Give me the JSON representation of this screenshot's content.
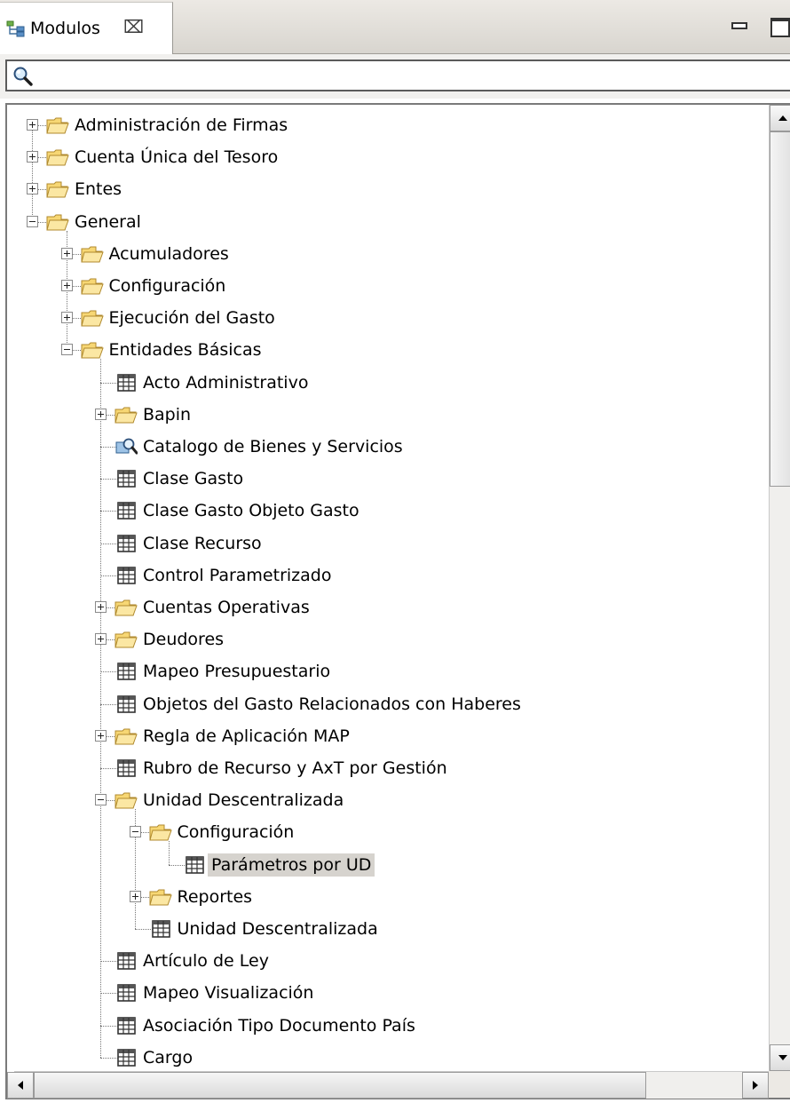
{
  "view": {
    "title": "Modulos",
    "close_glyph": "⌧",
    "icons": {
      "tab": "hierarchy-icon",
      "filter": "magnifier-icon",
      "minimize": "minimize-icon",
      "maximize": "maximize-icon"
    }
  },
  "filter": {
    "value": "",
    "placeholder": ""
  },
  "colors": {
    "folder": "#f5c542",
    "selection": "#d6d3ce"
  },
  "tree": [
    {
      "label": "Administración de Firmas",
      "depth": 0,
      "icon": "folder-icon",
      "expander": "closed"
    },
    {
      "label": "Cuenta Única del Tesoro",
      "depth": 0,
      "icon": "folder-icon",
      "expander": "closed"
    },
    {
      "label": "Entes",
      "depth": 0,
      "icon": "folder-icon",
      "expander": "closed"
    },
    {
      "label": "General",
      "depth": 0,
      "icon": "folder-icon",
      "expander": "open"
    },
    {
      "label": "Acumuladores",
      "depth": 1,
      "icon": "folder-icon",
      "expander": "closed"
    },
    {
      "label": "Configuración",
      "depth": 1,
      "icon": "folder-icon",
      "expander": "closed"
    },
    {
      "label": "Ejecución del Gasto",
      "depth": 1,
      "icon": "folder-icon",
      "expander": "closed"
    },
    {
      "label": "Entidades Básicas",
      "depth": 1,
      "icon": "folder-icon",
      "expander": "open"
    },
    {
      "label": "Acto Administrativo",
      "depth": 2,
      "icon": "table-icon",
      "expander": "none"
    },
    {
      "label": "Bapin",
      "depth": 2,
      "icon": "folder-icon",
      "expander": "closed"
    },
    {
      "label": "Catalogo de Bienes y Servicios",
      "depth": 2,
      "icon": "search-icon",
      "expander": "none"
    },
    {
      "label": "Clase Gasto",
      "depth": 2,
      "icon": "table-icon",
      "expander": "none"
    },
    {
      "label": "Clase Gasto Objeto Gasto",
      "depth": 2,
      "icon": "table-icon",
      "expander": "none"
    },
    {
      "label": "Clase Recurso",
      "depth": 2,
      "icon": "table-icon",
      "expander": "none"
    },
    {
      "label": "Control Parametrizado",
      "depth": 2,
      "icon": "table-icon",
      "expander": "none"
    },
    {
      "label": "Cuentas Operativas",
      "depth": 2,
      "icon": "folder-icon",
      "expander": "closed"
    },
    {
      "label": "Deudores",
      "depth": 2,
      "icon": "folder-icon",
      "expander": "closed"
    },
    {
      "label": "Mapeo Presupuestario",
      "depth": 2,
      "icon": "table-icon",
      "expander": "none"
    },
    {
      "label": "Objetos del Gasto Relacionados con Haberes",
      "depth": 2,
      "icon": "table-icon",
      "expander": "none"
    },
    {
      "label": "Regla de Aplicación MAP",
      "depth": 2,
      "icon": "folder-icon",
      "expander": "closed"
    },
    {
      "label": "Rubro de Recurso y AxT por Gestión",
      "depth": 2,
      "icon": "table-icon",
      "expander": "none"
    },
    {
      "label": "Unidad Descentralizada",
      "depth": 2,
      "icon": "folder-icon",
      "expander": "open"
    },
    {
      "label": "Configuración",
      "depth": 3,
      "icon": "folder-icon",
      "expander": "open"
    },
    {
      "label": "Parámetros por UD",
      "depth": 4,
      "icon": "table-icon",
      "expander": "none",
      "selected": true
    },
    {
      "label": "Reportes",
      "depth": 3,
      "icon": "folder-icon",
      "expander": "closed"
    },
    {
      "label": "Unidad Descentralizada",
      "depth": 3,
      "icon": "table-icon",
      "expander": "none"
    },
    {
      "label": "Artículo de Ley",
      "depth": 2,
      "icon": "table-icon",
      "expander": "none"
    },
    {
      "label": "Mapeo Visualización",
      "depth": 2,
      "icon": "table-icon",
      "expander": "none"
    },
    {
      "label": "Asociación Tipo Documento País",
      "depth": 2,
      "icon": "table-icon",
      "expander": "none"
    },
    {
      "label": "Cargo",
      "depth": 2,
      "icon": "table-icon",
      "expander": "none"
    }
  ]
}
